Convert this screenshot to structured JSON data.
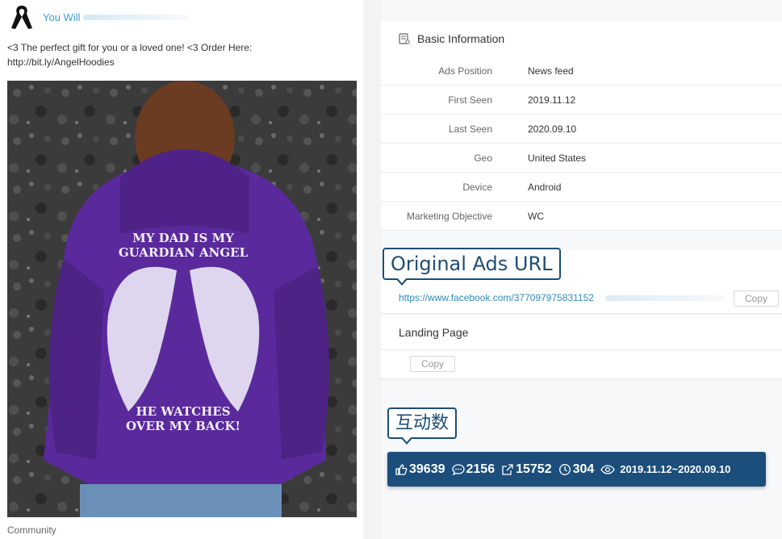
{
  "post": {
    "page_name": "You Will",
    "text": "<3 The perfect gift for you or a loved one! <3 Order Here: http://bit.ly/AngelHoodies",
    "image_print": {
      "top_line1": "MY DAD IS MY",
      "top_line2": "GUARDIAN ANGEL",
      "bottom_line1": "HE WATCHES",
      "bottom_line2": "OVER MY BACK!"
    },
    "footer": "Community"
  },
  "basic_info": {
    "title": "Basic Information",
    "rows": [
      {
        "label": "Ads Position",
        "value": "News feed"
      },
      {
        "label": "First Seen",
        "value": "2019.11.12"
      },
      {
        "label": "Last Seen",
        "value": "2020.09.10"
      },
      {
        "label": "Geo",
        "value": "United States"
      },
      {
        "label": "Device",
        "value": "Android"
      },
      {
        "label": "Marketing Objective",
        "value": "WC"
      }
    ]
  },
  "original_url": {
    "callout": "Original Ads URL",
    "url": "https://www.facebook.com/377097975831152",
    "copy_label": "Copy"
  },
  "landing_page": {
    "title": "Landing Page",
    "copy_label": "Copy"
  },
  "interactions": {
    "callout": "互动数",
    "likes": "39639",
    "comments": "2156",
    "shares": "15752",
    "days": "304",
    "date_range": "2019.11.12~2020.09.10"
  },
  "colors": {
    "accent_blue": "#3d9bd2",
    "callout_navy": "#1e4d74",
    "stats_bg": "#1c4e7c",
    "hoodie_purple": "#5a2a9c"
  }
}
